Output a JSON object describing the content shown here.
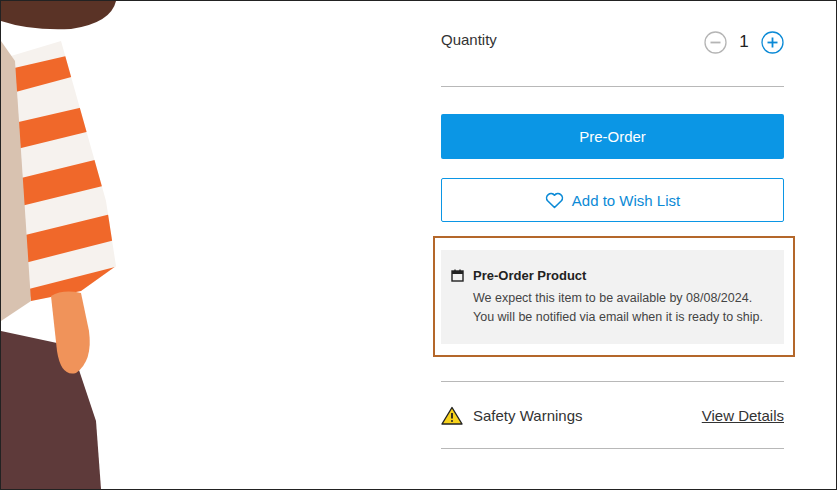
{
  "quantity": {
    "label": "Quantity",
    "value": "1",
    "decrement": {
      "disabled": true
    },
    "increment": {
      "disabled": false
    }
  },
  "buttons": {
    "preorder": "Pre-Order",
    "wishlist": "Add to Wish List"
  },
  "notice": {
    "title": "Pre-Order Product",
    "message": "We expect this item to be available by 08/08/2024. You will be notified via email when it is ready to ship."
  },
  "safety": {
    "label": "Safety Warnings",
    "link": "View Details"
  }
}
